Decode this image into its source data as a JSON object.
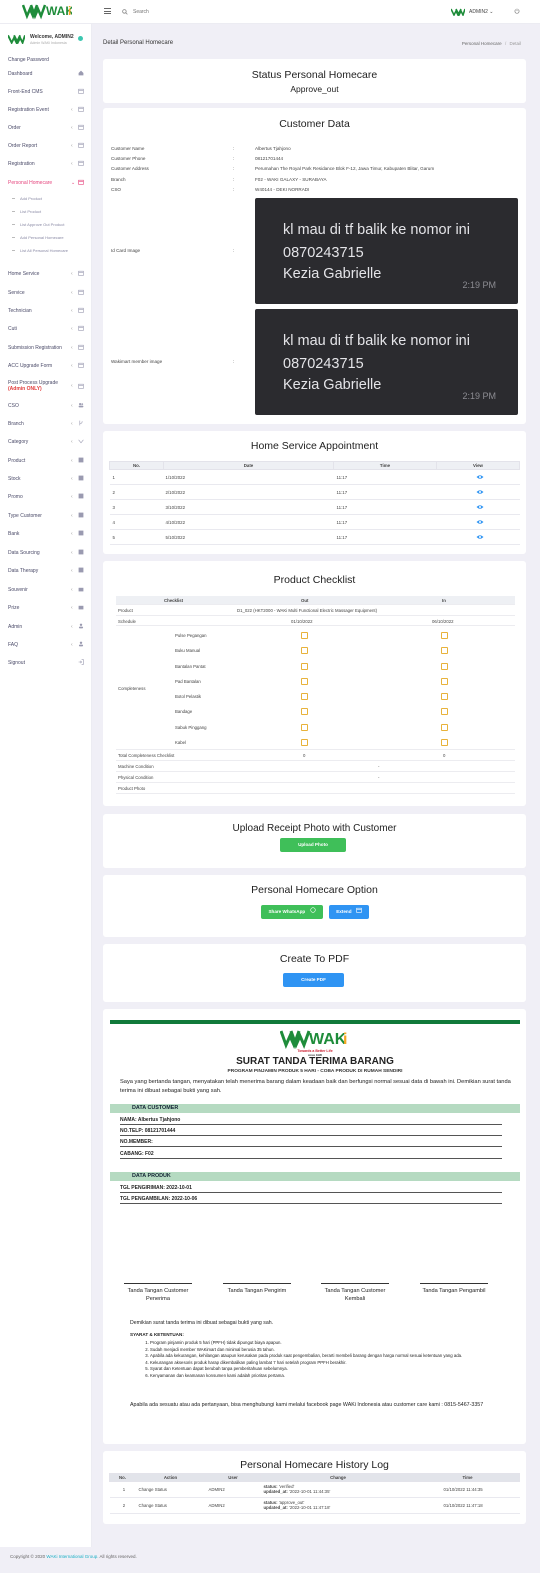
{
  "app": {
    "brand": "WAKi",
    "brand_tagline": "Towards a Better Life",
    "brand_since": "since 1995"
  },
  "topbar": {
    "search_placeholder": "Search",
    "user": "ADMIN2"
  },
  "sidebar": {
    "welcome": "Welcome, ADMIN2",
    "role": "Admin WAKi Indonesia",
    "items": [
      {
        "label": "Change Password"
      },
      {
        "label": "Dashboard"
      },
      {
        "label": "Front-End CMS"
      },
      {
        "label": "Registration Event"
      },
      {
        "label": "Order"
      },
      {
        "label": "Order Report"
      },
      {
        "label": "Registration"
      },
      {
        "label": "Personal Homecare"
      },
      {
        "label": "Home Service"
      },
      {
        "label": "Service"
      },
      {
        "label": "Technician"
      },
      {
        "label": "Cuti"
      },
      {
        "label": "Submission Registration"
      },
      {
        "label": "ACC Upgrade Form"
      },
      {
        "label": "Post Process Upgrade",
        "note": "(Admin ONLY)"
      },
      {
        "label": "CSO"
      },
      {
        "label": "Branch"
      },
      {
        "label": "Category"
      },
      {
        "label": "Product"
      },
      {
        "label": "Stock"
      },
      {
        "label": "Promo"
      },
      {
        "label": "Type Customer"
      },
      {
        "label": "Bank"
      },
      {
        "label": "Data Sourcing"
      },
      {
        "label": "Data Therapy"
      },
      {
        "label": "Souvenir"
      },
      {
        "label": "Prize"
      },
      {
        "label": "Admin"
      },
      {
        "label": "FAQ"
      },
      {
        "label": "Signout"
      }
    ],
    "subitems": [
      "Add Product",
      "List Product",
      "List Approve Out Product",
      "Add Personal Homecare",
      "List All Personal Homecare"
    ]
  },
  "page": {
    "title": "Detail Personal Homecare",
    "breadcrumb_parent": "Personal Homecare",
    "breadcrumb_sep": "/",
    "breadcrumb_current": "Detail"
  },
  "status": {
    "title": "Status Personal Homecare",
    "value": "Approve_out"
  },
  "customer": {
    "title": "Customer Data",
    "colon": ":",
    "name_label": "Customer Name",
    "name": "Albertus Tjahjono",
    "phone_label": "Customer Phone",
    "phone": "08121701444",
    "address_label": "Customer Address",
    "address": "Perumahan The Royal Park Residance Blok F-12, Jawa Timur, Kabupaten Blitar, Garum",
    "branch_label": "Branch",
    "branch": "F02 - WAKI GALAXY - SURABAYA",
    "cso_label": "CSO",
    "cso": "W40144 - DEKI NORRADI",
    "idcard_label": "Id Card Image",
    "member_label": "Wakimart member image",
    "image_lines": [
      "kl mau di tf balik ke nomor ini",
      "0870243715",
      "Kezia Gabrielle"
    ],
    "image_time": "2:19 PM"
  },
  "appointment": {
    "title": "Home Service Appointment",
    "headers": [
      "No.",
      "Date",
      "Time",
      "View"
    ],
    "rows": [
      [
        "1",
        "1/10/2022",
        "11:17"
      ],
      [
        "2",
        "2/10/2022",
        "11:17"
      ],
      [
        "3",
        "3/10/2022",
        "11:17"
      ],
      [
        "4",
        "4/10/2022",
        "11:17"
      ],
      [
        "5",
        "5/10/2022",
        "11:17"
      ]
    ]
  },
  "checklist": {
    "title": "Product Checklist",
    "headers": [
      "Checklist",
      "Out",
      "In"
    ],
    "product_label": "Product",
    "product": "D1_022 (HKT2000 - WAKi Multi Functional Electric Massager Equipment)",
    "schedule_label": "Schedule",
    "schedule_out": "01/10/2022",
    "schedule_in": "06/10/2022",
    "completeness_label": "Completeness",
    "items": [
      "Pulse Pegangan",
      "Buku Manual",
      "Bantalan Pantat",
      "Pad Bantalan",
      "Botol Pelastik",
      "Bandage",
      "Sabuk Pinggang",
      "Kabel"
    ],
    "total_label": "Total Completeness Checklist",
    "total_out": "0",
    "total_in": "0",
    "machine_label": "Machine Condition",
    "machine_in": "-",
    "physical_label": "Physical Condition",
    "physical_in": "-",
    "photo_label": "Product Photo"
  },
  "upload": {
    "title": "Upload Receipt Photo with Customer",
    "button": "Upload Photo"
  },
  "option": {
    "title": "Personal Homecare Option",
    "whatsapp": "Share WhatsApp",
    "extend": "Extend"
  },
  "pdf": {
    "title": "Create To PDF",
    "button": "Create PDF"
  },
  "document": {
    "title": "SURAT TANDA TERIMA BARANG",
    "subtitle": "PROGRAM PINJAMIN PRODUK 5 HARI - COBA PRODUK DI RUMAH SENDIRI",
    "intro": "Saya yang bertanda tangan, menyatakan telah menerima barang dalam keadaan baik dan berfungsi normal sesuai data di bawah ini. Demikian surat tanda terima ini dibuat sebagai bukti yang sah.",
    "section_customer": "DATA CUSTOMER",
    "name": "NAMA: Albertus Tjahjono",
    "phone": "NO.TELP: 08121701444",
    "member": "NO.MEMBER:",
    "branch": "CABANG: F02",
    "section_product": "DATA PRODUK",
    "send_date": "TGL PENGIRIMAN: 2022-10-01",
    "take_date": "TGL PENGAMBILAN: 2022-10-06",
    "signatures": [
      "Tanda Tangan Customer Penerima",
      "Tanda Tangan Pengirim",
      "Tanda Tangan Customer Kembali",
      "Tanda Tangan Pengambil"
    ],
    "closing": "Demikian surat tanda terima ini dibuat sebagai bukti yang sah.",
    "terms_title": "SYARAT & KETENTUAN:",
    "terms": [
      "Program pinjamin produk 5 hari (PPFH) tidak dipungut biaya apapun.",
      "Sudah menjadi member WAKimart dan minimal berusia 35 tahun.",
      "Apabila ada kekurangan, kehilangan ataupun kerusakan pada produk saat pengembalian, berarti membeli barang dengan harga normal sesuai ketentuan yang ada.",
      "Kekurangan aksesoris produk harap dikembalikan paling lambat 7 hari setelah program PPFH berakhir.",
      "Syarat dan Ketentuan dapat berubah tanpa pemberitahuan sebelumnya.",
      "Kenyamanan dan keamanan konsumen kami adalah prioritas pertama."
    ],
    "contact": "Apabila ada sesuatu atau ada pertanyaan, bisa menghubungi kami melalui facebook page WAKi Indonesia atau customer care kami : 0815-5467-3357"
  },
  "history": {
    "title": "Personal Homecare History Log",
    "headers": [
      "No.",
      "Action",
      "User",
      "Change",
      "Time"
    ],
    "rows": [
      {
        "no": "1",
        "action": "Change Status",
        "user": "ADMIN2",
        "status_label": "status:",
        "status": "verified",
        "updated_label": "updated_at:",
        "updated": "2022-10-01 11:44:35",
        "time": "01/10/2022 11:44:35"
      },
      {
        "no": "2",
        "action": "Change Status",
        "user": "ADMIN2",
        "status_label": "status:",
        "status": "approve_out",
        "updated_label": "updated_at:",
        "updated": "2022-10-01 11:47:18",
        "time": "01/10/2022 11:47:18"
      }
    ]
  },
  "footer": {
    "prefix": "Copyright © 2020",
    "company": "WAKi International Group.",
    "suffix": "All rights reserved."
  },
  "colors": {
    "accent": "#e5457d",
    "green": "#3fbf59",
    "blue": "#2f94f3",
    "checkbox": "#e8b23a",
    "doc_green": "#117a3a"
  }
}
